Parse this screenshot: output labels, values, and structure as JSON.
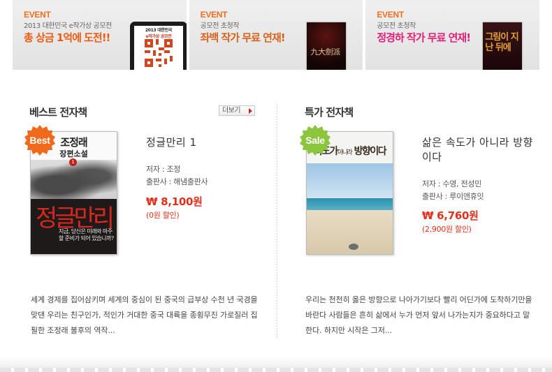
{
  "banners": [
    {
      "event": "EVENT",
      "sub": "2013 대한민국 e작가상 공모전",
      "head": "총 상금 1억에 도전!!",
      "tablet_line1": "2013 대한민국",
      "tablet_line2": "e작가상 공모전"
    },
    {
      "event": "EVENT",
      "sub": "공모전 초청작",
      "head": "좌백 작가 무료 연재!",
      "cover_text": "九大劍派"
    },
    {
      "event": "EVENT",
      "sub": "공모전 초청작",
      "head": "정경하 작가 무료 연재!",
      "cover_text": "그림이 지난 뒤에"
    }
  ],
  "best": {
    "section_title": "베스트 전자책",
    "more_label": "더보기",
    "badge": "Best",
    "badge_color": "#ef6a1c",
    "title": "정글만리 1",
    "author": "저자 : 조정",
    "publisher": "출판사 : 해냄출판사",
    "price": "₩ 8,100원",
    "discount": "(0원 할인)",
    "description": "세계 경제를 집어삼키며 세계의 중심이 된 중국의 급부상 수천 년 국경을 맞댄 우리는 친구인가, 적인가 거대한 중국 대륙을 종횡무진 가로질러 집필한 조정래 불후의 역작...",
    "cover": {
      "author": "조정래",
      "genre": "장편소설",
      "volume": "1",
      "big_title": "정글만리",
      "quote": "지금, 당신은 미래와 마주할 준비가 되어 있습니까?"
    }
  },
  "sale": {
    "section_title": "특가 전자책",
    "badge": "Sale",
    "badge_color": "#8cc63f",
    "title": "삶은 속도가 아니라 방향이다",
    "author": "저자 : 수영, 전성민",
    "publisher": "출판사 : 루이앤휴잇",
    "price": "₩ 6,760원",
    "discount": "(2,900원 할인)",
    "description": "우리는 천천히 옳은 방향으로 나아가기보다 빨리 어딘가에 도착하기만을 바란다 사람들은 흔히 삶에서 누가 먼저 앞서 나가는지가 중요하다고 말한다. 하지만 시작은 그저...",
    "cover": {
      "title_main": "속도가",
      "title_mid": "아니라",
      "title_end": "방향이다"
    }
  }
}
